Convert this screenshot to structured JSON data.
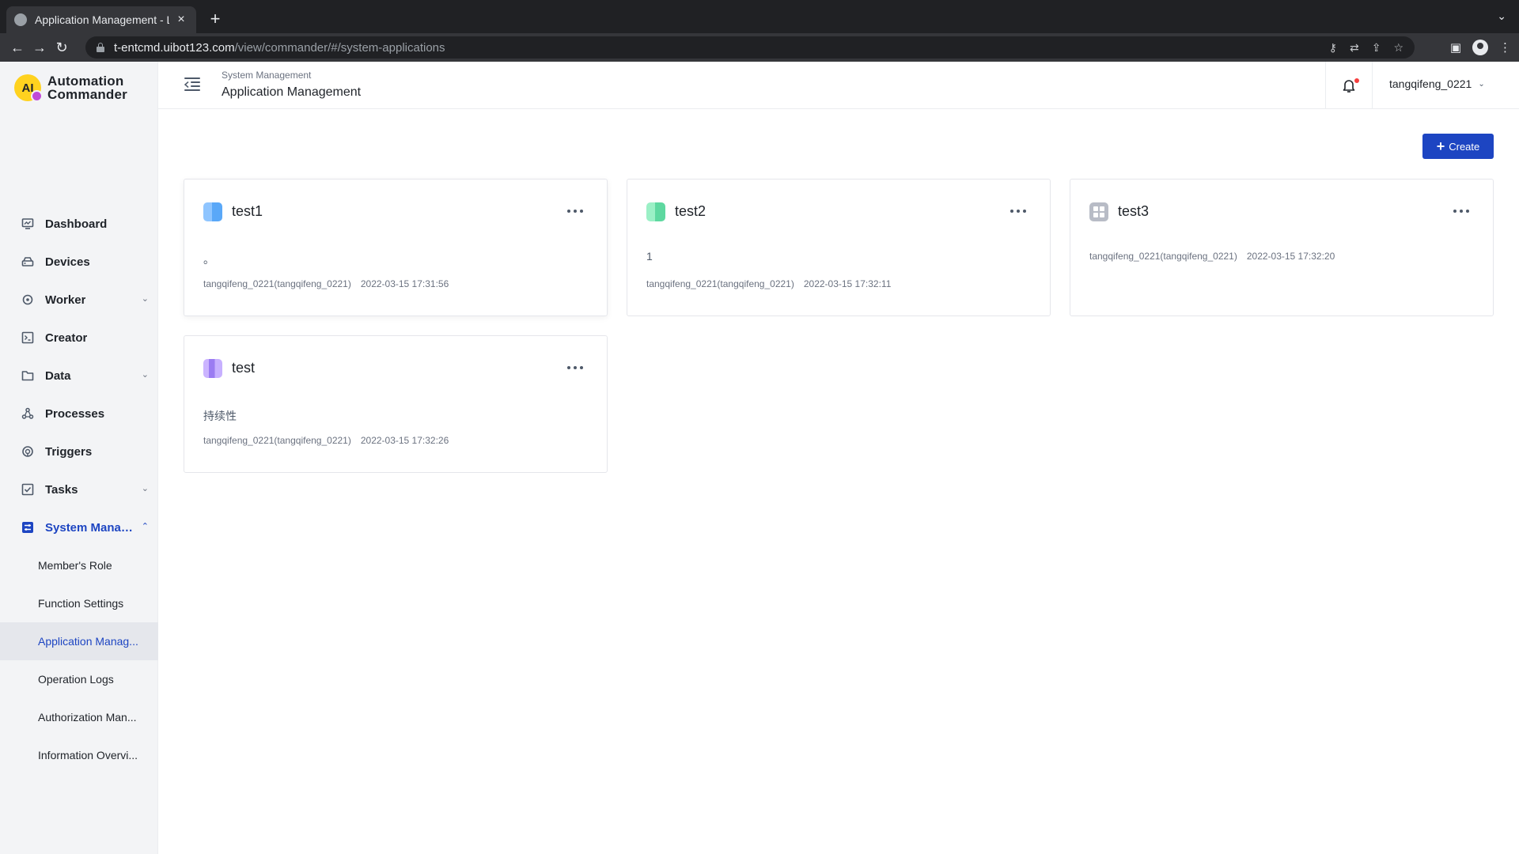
{
  "browser": {
    "tab_title": "Application Management - Laiy",
    "tab_close": "×",
    "new_tab": "+",
    "tab_list": "⌄",
    "back": "←",
    "forward": "→",
    "reload": "↻",
    "url_host": "t-entcmd.uibot123.com",
    "url_path": "/view/commander/#/system-applications"
  },
  "app": {
    "logo_line1": "Automation",
    "logo_line2": "Commander",
    "logo_mark": "AI"
  },
  "sidebar": {
    "items": [
      {
        "label": "Dashboard",
        "icon": "dashboard-icon"
      },
      {
        "label": "Devices",
        "icon": "devices-icon"
      },
      {
        "label": "Worker",
        "icon": "worker-icon",
        "expandable": true
      },
      {
        "label": "Creator",
        "icon": "creator-icon"
      },
      {
        "label": "Data",
        "icon": "data-icon",
        "expandable": true
      },
      {
        "label": "Processes",
        "icon": "processes-icon"
      },
      {
        "label": "Triggers",
        "icon": "triggers-icon"
      },
      {
        "label": "Tasks",
        "icon": "tasks-icon",
        "expandable": true
      },
      {
        "label": "System Manag...",
        "icon": "system-management-icon",
        "expanded": true
      }
    ],
    "sub_items": [
      {
        "label": "Member's Role"
      },
      {
        "label": "Function Settings"
      },
      {
        "label": "Application Manag...",
        "selected": true
      },
      {
        "label": "Operation Logs"
      },
      {
        "label": "Authorization Man..."
      },
      {
        "label": "Information Overvi..."
      }
    ]
  },
  "header": {
    "breadcrumb_parent": "System Management",
    "title": "Application Management",
    "user": "tangqifeng_0221"
  },
  "actions": {
    "create_label": "Create"
  },
  "applications": [
    {
      "name": "test1",
      "description": "。",
      "owner": "tangqifeng_0221(tangqifeng_0221)",
      "date": "2022-03-15 17:31:56",
      "icon": "blue-cube-icon"
    },
    {
      "name": "test2",
      "description": "1",
      "owner": "tangqifeng_0221(tangqifeng_0221)",
      "date": "2022-03-15 17:32:11",
      "icon": "green-cube-icon"
    },
    {
      "name": "test3",
      "description": "",
      "owner": "tangqifeng_0221(tangqifeng_0221)",
      "date": "2022-03-15 17:32:20",
      "icon": "grid-icon"
    },
    {
      "name": "test",
      "description": "持续性",
      "owner": "tangqifeng_0221(tangqifeng_0221)",
      "date": "2022-03-15 17:32:26",
      "icon": "purple-cube-icon"
    }
  ],
  "colors": {
    "accent": "#1d45c2",
    "sidebar_bg": "#f3f4f6",
    "notification_dot": "#f53f3f"
  }
}
